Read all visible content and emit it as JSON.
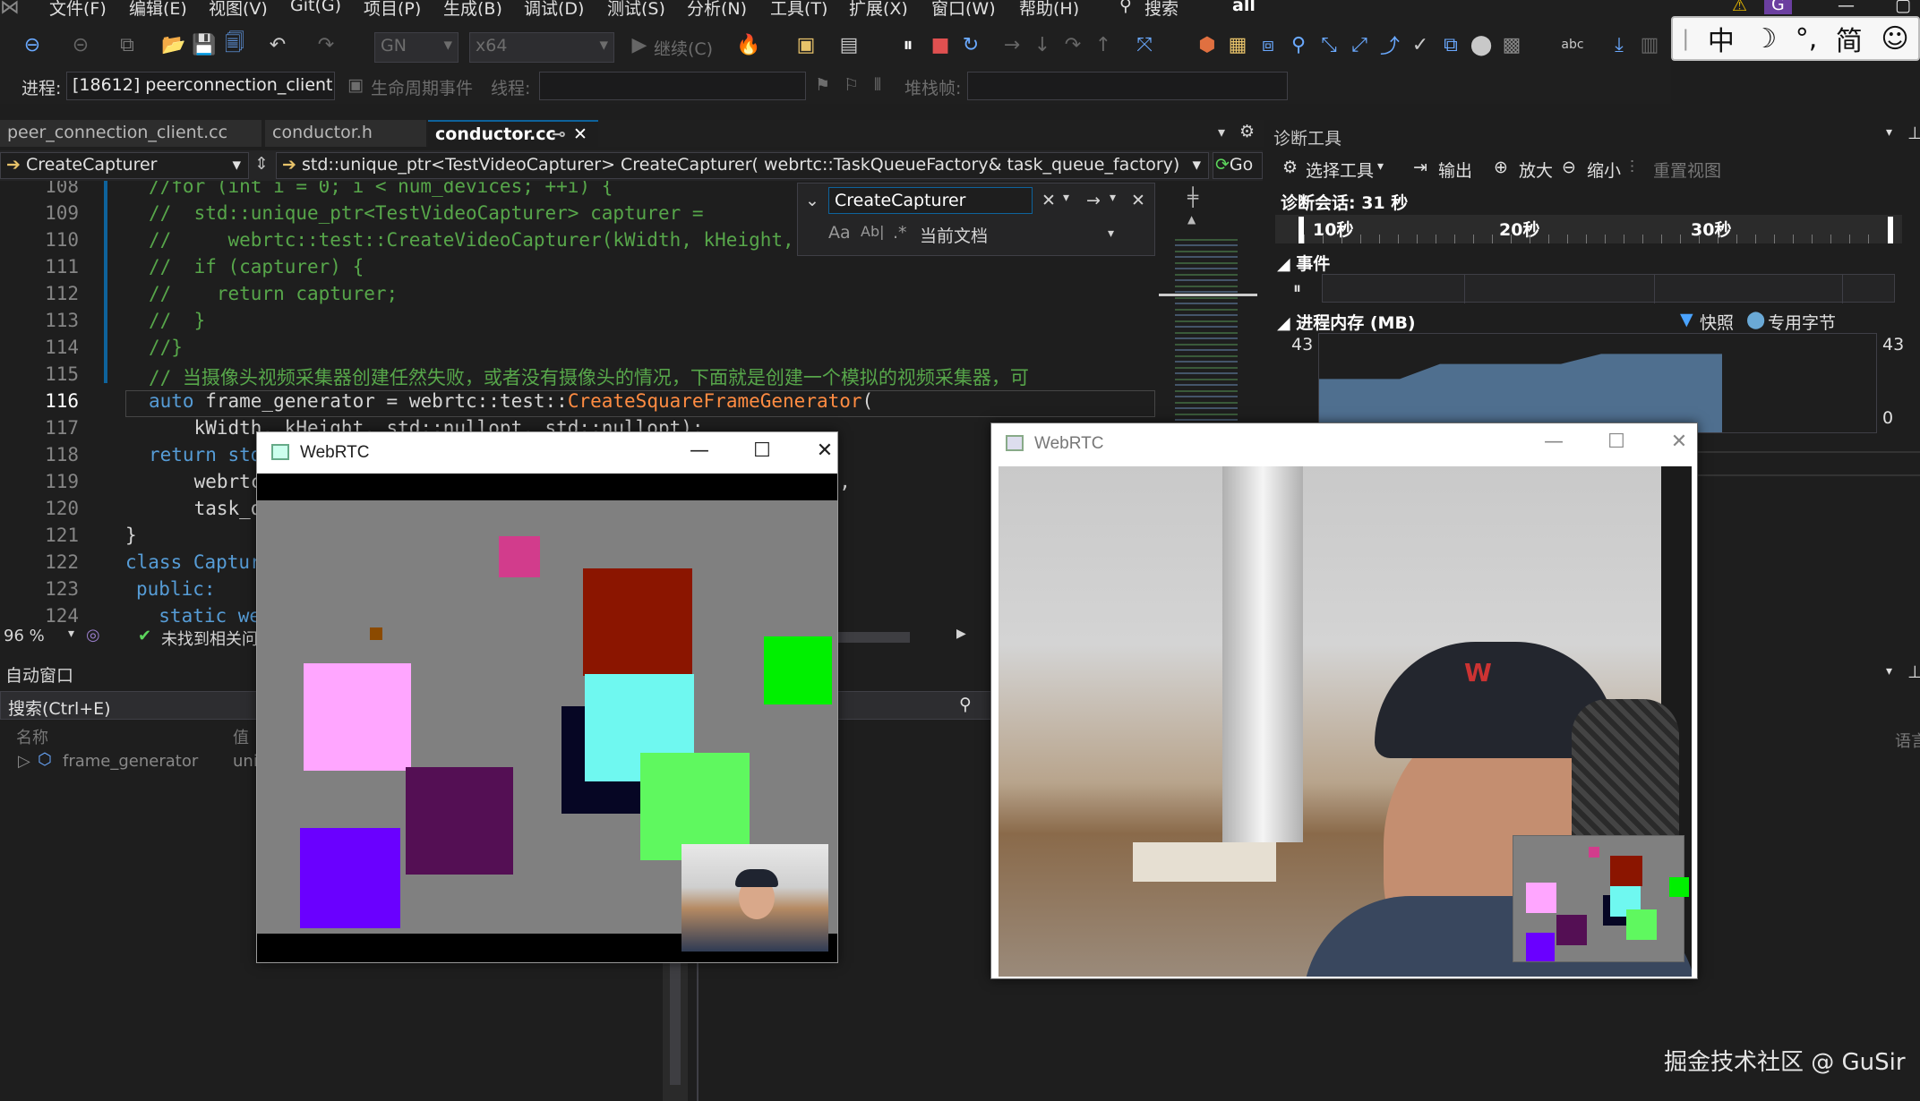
{
  "menu": [
    "文件(F)",
    "编辑(E)",
    "视图(V)",
    "Git(G)",
    "项目(P)",
    "生成(B)",
    "调试(D)",
    "测试(S)",
    "分析(N)",
    "工具(T)",
    "扩展(X)",
    "窗口(W)",
    "帮助(H)"
  ],
  "menu_search": "搜索",
  "solution_name": "all",
  "toolbar": {
    "config": "GN",
    "platform": "x64",
    "continue": "继续(C)"
  },
  "process_bar": {
    "process_label": "进程:",
    "process_value": "[18612] peerconnection_client.‹",
    "lifecycle": "生命周期事件",
    "thread_label": "线程:",
    "stack_label": "堆栈帧:"
  },
  "ime": [
    "中",
    "☽",
    "°,",
    "简",
    "☺"
  ],
  "tabs": [
    {
      "label": "peer_connection_client.cc",
      "active": false
    },
    {
      "label": "conductor.h",
      "active": false
    },
    {
      "label": "conductor.cc",
      "active": true
    }
  ],
  "navbar": {
    "scope": "CreateCapturer",
    "signature": "std::unique_ptr<TestVideoCapturer> CreateCapturer( webrtc::TaskQueueFactory& task_queue_factory)",
    "go": "Go"
  },
  "find": {
    "query": "CreateCapturer",
    "match_case": "Aa",
    "whole_word": "Ab|",
    "scope": "当前文档"
  },
  "code_lines": [
    {
      "n": "108",
      "text": "//for (int i = 0; i < num_devices; ++i) {"
    },
    {
      "n": "109",
      "text": "//  std::unique_ptr<TestVideoCapturer> capturer ="
    },
    {
      "n": "110",
      "text": "//     webrtc::test::CreateVideoCapturer(kWidth, kHeight, k"
    },
    {
      "n": "111",
      "text": "//  if (capturer) {"
    },
    {
      "n": "112",
      "text": "//    return capturer;"
    },
    {
      "n": "113",
      "text": "//  }"
    },
    {
      "n": "114",
      "text": "//}"
    },
    {
      "n": "115",
      "text": "// 当摄像头视频采集器创建任然失败，或者没有摄像头的情况，下面就是创建一个模拟的视频采集器，可"
    },
    {
      "n": "116",
      "text": "auto frame_generator = webrtc::test::CreateSquareFrameGenerator("
    },
    {
      "n": "117",
      "text": "    kWidth, kHeight, std::nullopt, std::nullopt);"
    },
    {
      "n": "118",
      "text": "return std"
    },
    {
      "n": "119",
      "text": "    webrtc                                           r), kFps,"
    },
    {
      "n": "120",
      "text": "    task_q"
    },
    {
      "n": "121",
      "text": "}"
    },
    {
      "n": "122",
      "text": "class Captur"
    },
    {
      "n": "123",
      "text": "public:"
    },
    {
      "n": "124",
      "text": "  static web"
    }
  ],
  "status": {
    "zoom": "96 %",
    "issues": "未找到相关问题"
  },
  "auto_window": {
    "title": "自动窗口",
    "search": "搜索(Ctrl+E)",
    "col_name": "名称",
    "col_value": "值",
    "col_lang": "语言",
    "row_name": "frame_generator",
    "row_value": "uni"
  },
  "diag": {
    "title": "诊断工具",
    "select_tool": "选择工具",
    "output": "输出",
    "zoom_in": "放大",
    "zoom_out": "缩小",
    "reset_view": "重置视图",
    "session": "诊断会话: 31 秒",
    "ticks": [
      "10秒",
      "20秒",
      "30秒"
    ],
    "events": "事件",
    "memory": "进程内存 (MB)",
    "legend_snapshot": "快照",
    "legend_private": "专用字节",
    "mem_max": "43",
    "mem_min": "0"
  },
  "memory_level": [
    0.55,
    0.55,
    0.55,
    0.7,
    0.7,
    0.7,
    0.7,
    0.8,
    0.8,
    0.8,
    0.8
  ],
  "window_left": {
    "title": "WebRTC"
  },
  "window_right": {
    "title": "WebRTC"
  },
  "watermark": "掘金技术社区 @ GuSir"
}
